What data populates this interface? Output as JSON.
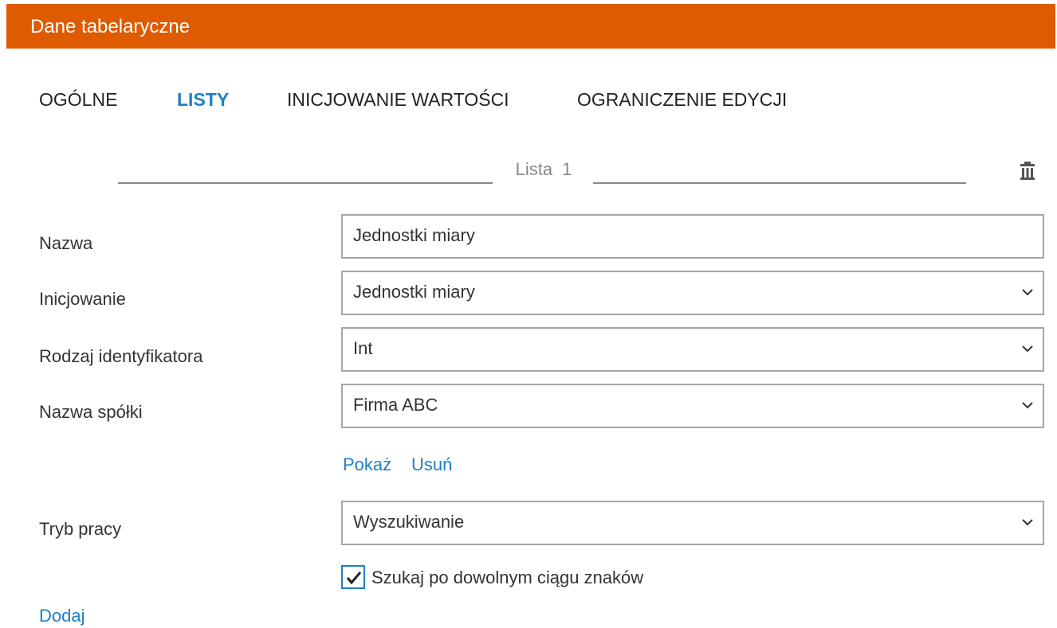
{
  "window": {
    "title": "Dane tabelaryczne"
  },
  "colors": {
    "header_bg": "#df5b00",
    "accent": "#1f80c4"
  },
  "tabs": [
    {
      "label": "OGÓLNE",
      "active": false
    },
    {
      "label": "LISTY",
      "active": true
    },
    {
      "label": "INICJOWANIE WARTOŚCI",
      "active": false
    },
    {
      "label": "OGRANICZENIE EDYCJI",
      "active": false
    }
  ],
  "list_header": {
    "label": "Lista",
    "number": "1",
    "delete_icon": "trash-icon"
  },
  "form": {
    "nazwa": {
      "label": "Nazwa",
      "value": "Jednostki miary"
    },
    "inicjowanie": {
      "label": "Inicjowanie",
      "value": "Jednostki miary"
    },
    "rodzaj": {
      "label": "Rodzaj identyfikatora",
      "value": "Int"
    },
    "spolka": {
      "label": "Nazwa spółki",
      "value": "Firma ABC"
    },
    "links": {
      "show": "Pokaż",
      "remove": "Usuń"
    },
    "tryb": {
      "label": "Tryb pracy",
      "value": "Wyszukiwanie"
    },
    "search_any": {
      "label": "Szukaj po dowolnym ciągu znaków",
      "checked": true
    }
  },
  "footer": {
    "add": "Dodaj"
  }
}
